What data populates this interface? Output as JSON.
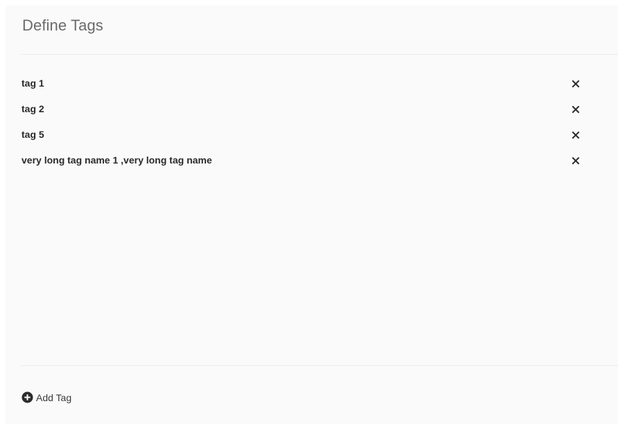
{
  "dialog": {
    "title": "Define Tags"
  },
  "tags": [
    {
      "label": "tag 1",
      "remove_icon": "close-icon"
    },
    {
      "label": "tag 2",
      "remove_icon": "close-icon"
    },
    {
      "label": "tag 5",
      "remove_icon": "close-icon"
    },
    {
      "label": "very long tag name 1 ,very long tag name",
      "remove_icon": "close-icon"
    }
  ],
  "footer": {
    "add_label": "Add Tag",
    "add_icon": "plus-circle-icon"
  },
  "colors": {
    "panel_background": "#fafafa",
    "title_text": "#6b6b6b",
    "tag_text": "#2a2a2a",
    "divider": "#ececec",
    "icon": "#2b2b2b"
  }
}
